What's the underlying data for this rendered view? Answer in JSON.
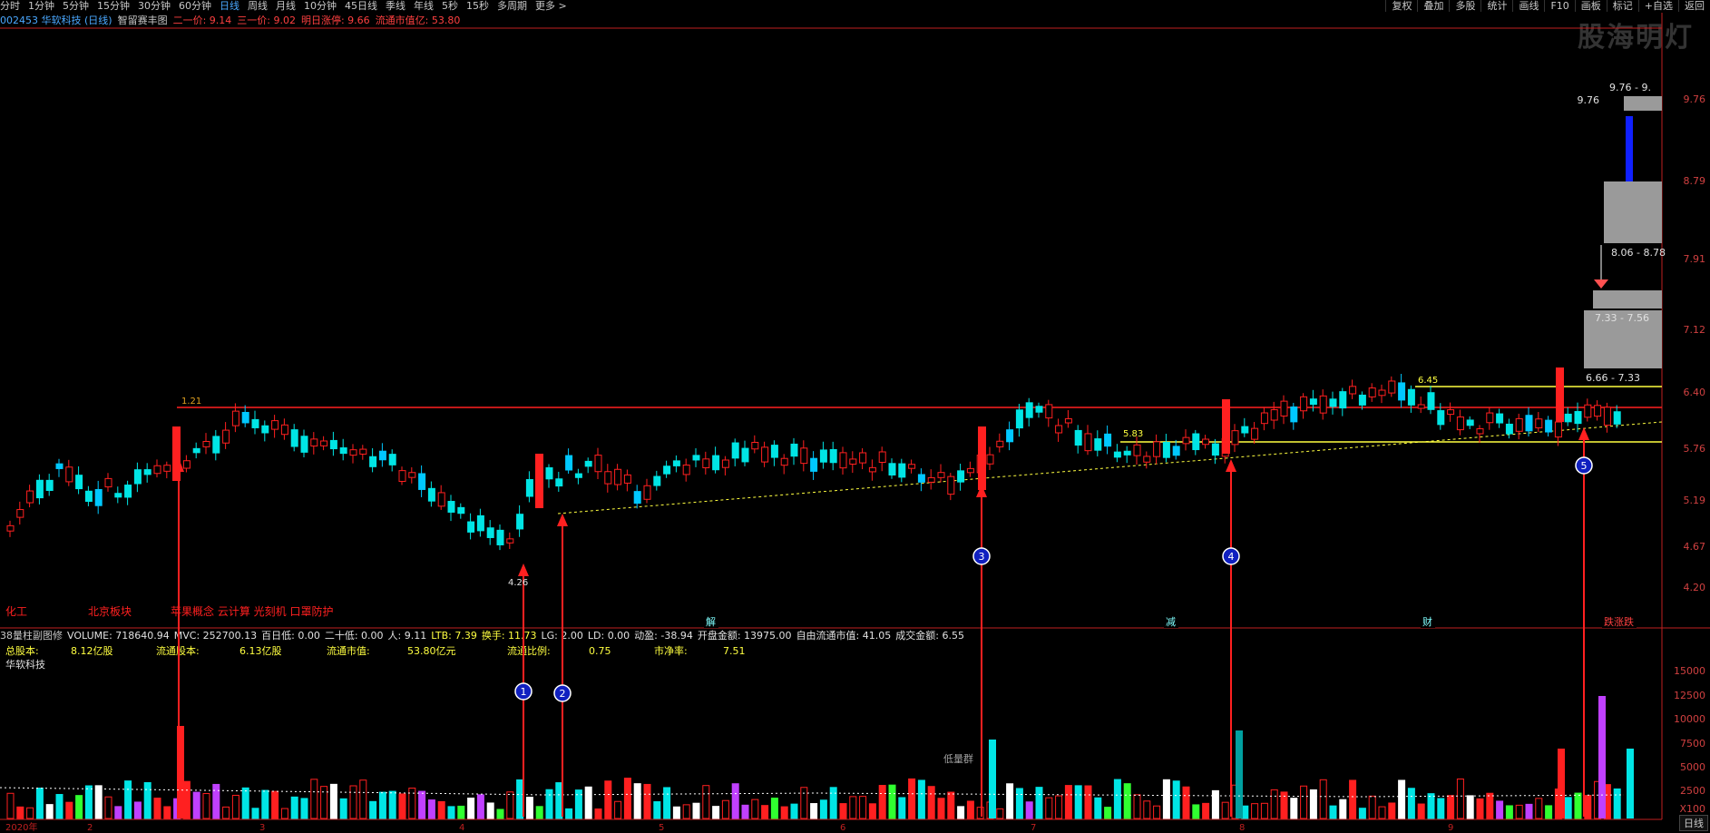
{
  "timeframes": [
    "分时",
    "1分钟",
    "5分钟",
    "15分钟",
    "30分钟",
    "60分钟",
    "日线",
    "周线",
    "月线",
    "10分钟",
    "45日线",
    "季线",
    "年线",
    "5秒",
    "15秒",
    "多周期",
    "更多 >"
  ],
  "active_timeframe": 6,
  "right_menu": [
    "复权",
    "叠加",
    "多股",
    "统计",
    "画线",
    "F10",
    "画板",
    "标记",
    "+自选",
    "返回"
  ],
  "logo": "股海明灯",
  "info": {
    "code": "002453 华软科技 (日线)",
    "indicator": "智留赛丰图",
    "i1": "二一价: 9.14",
    "i2": "三一价: 9.02",
    "i3": "明日涨停: 9.66",
    "i4": "流通市值亿: 53.80"
  },
  "y_ticks": [
    "9.76",
    "8.79",
    "7.91",
    "7.12",
    "6.40",
    "5.76",
    "5.19",
    "4.67",
    "4.20"
  ],
  "price_labels": {
    "top_range": "9.76 - 9.",
    "top_price": "9.76",
    "r1": "8.06 - 8.78",
    "r2": "7.33 - 7.56",
    "r3": "6.66 - 7.33",
    "l645": "6.45",
    "l583": "5.83",
    "l121": "1.21",
    "low": "4.26"
  },
  "sector_tags": [
    "化工",
    "北京板块",
    "苹果概念 云计算 光刻机 口罩防护"
  ],
  "event_tags": [
    "解",
    "减",
    "财",
    "跌涨跌"
  ],
  "stats": {
    "name": "38量柱副图修",
    "volume": "VOLUME: 718640.94",
    "mvc": "MVC: 252700.13",
    "bairi": "百日低: 0.00",
    "ershi": "二十低: 0.00",
    "ren": "人: 9.11",
    "ltb": "LTB: 7.39",
    "gaiyu": "换手: 11.73",
    "lg": "LG: 2.00",
    "ld": "LD: 0.00",
    "dongying": "动盈: -38.94",
    "kaipan": "开盘金额: 13975.00",
    "ziyou": "自由流通市值: 41.05",
    "chengjiao": "成交金额: 6.55"
  },
  "fund": {
    "zgb_l": "总股本:",
    "zgb_v": "8.12亿股",
    "ltgb_l": "流通股本:",
    "ltgb_v": "6.13亿股",
    "ltsz_l": "流通市值:",
    "ltsz_v": "53.80亿元",
    "ltbl_l": "流通比例:",
    "ltbl_v": "0.75",
    "sjl_l": "市净率:",
    "sjl_v": "7.51",
    "stock": "华软科技"
  },
  "vol_ticks": [
    "15000",
    "12500",
    "10000",
    "7500",
    "5000",
    "2500",
    "X100"
  ],
  "x_labels": [
    "2020年",
    "2",
    "3",
    "4",
    "5",
    "6",
    "7",
    "8",
    "9"
  ],
  "markers": [
    "1",
    "2",
    "3",
    "4",
    "5"
  ],
  "low_group": "低量群",
  "bottom_tab": "日线",
  "colors": {
    "up": "#ff2020",
    "down": "#00e0e0",
    "axis": "#c02020",
    "yellow": "#ffff40"
  }
}
